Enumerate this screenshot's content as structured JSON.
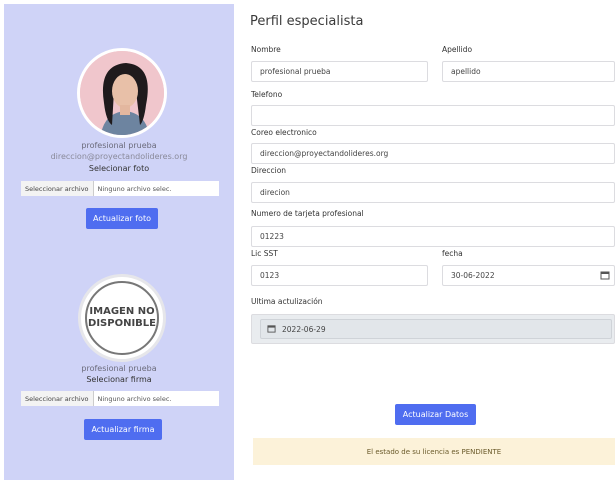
{
  "sidebar": {
    "profile_name": "profesional prueba",
    "profile_email": "direccion@proyectandolideres.org",
    "select_photo_label": "Selecionar foto",
    "file_button": "Seleccionar archivo",
    "file_none": "Ninguno archivo selec.",
    "update_photo_button": "Actualizar foto",
    "no_image_line1": "IMAGEN NO",
    "no_image_line2": "DISPONIBLE",
    "signature_name": "profesional prueba",
    "select_signature_label": "Selecionar firma",
    "file_button_2": "Seleccionar archivo",
    "file_none_2": "Ninguno archivo selec.",
    "update_signature_button": "Actualizar firma"
  },
  "form": {
    "title": "Perfil especialista",
    "nombre_label": "Nombre",
    "nombre_value": "profesional prueba",
    "apellido_label": "Apellido",
    "apellido_value": "apellido",
    "telefono_label": "Telefono",
    "telefono_value": "",
    "correo_label": "Coreo electronico",
    "correo_value": "direccion@proyectandolideres.org",
    "direccion_label": "Direccion",
    "direccion_value": "direcion",
    "tarjeta_label": "Numero de tarjeta profesional",
    "tarjeta_value": "01223",
    "lic_label": "Lic SST",
    "lic_value": "0123",
    "fecha_label": "fecha",
    "fecha_value": "30-06-2022",
    "ultima_label": "Ultima actulización",
    "ultima_value": "2022-06-29",
    "submit_button": "Actualizar Datos",
    "alert_text": "El estado de su licencia es PENDIENTE"
  },
  "icons": {
    "calendar": "calendar-icon",
    "avatar": "avatar-photo"
  }
}
